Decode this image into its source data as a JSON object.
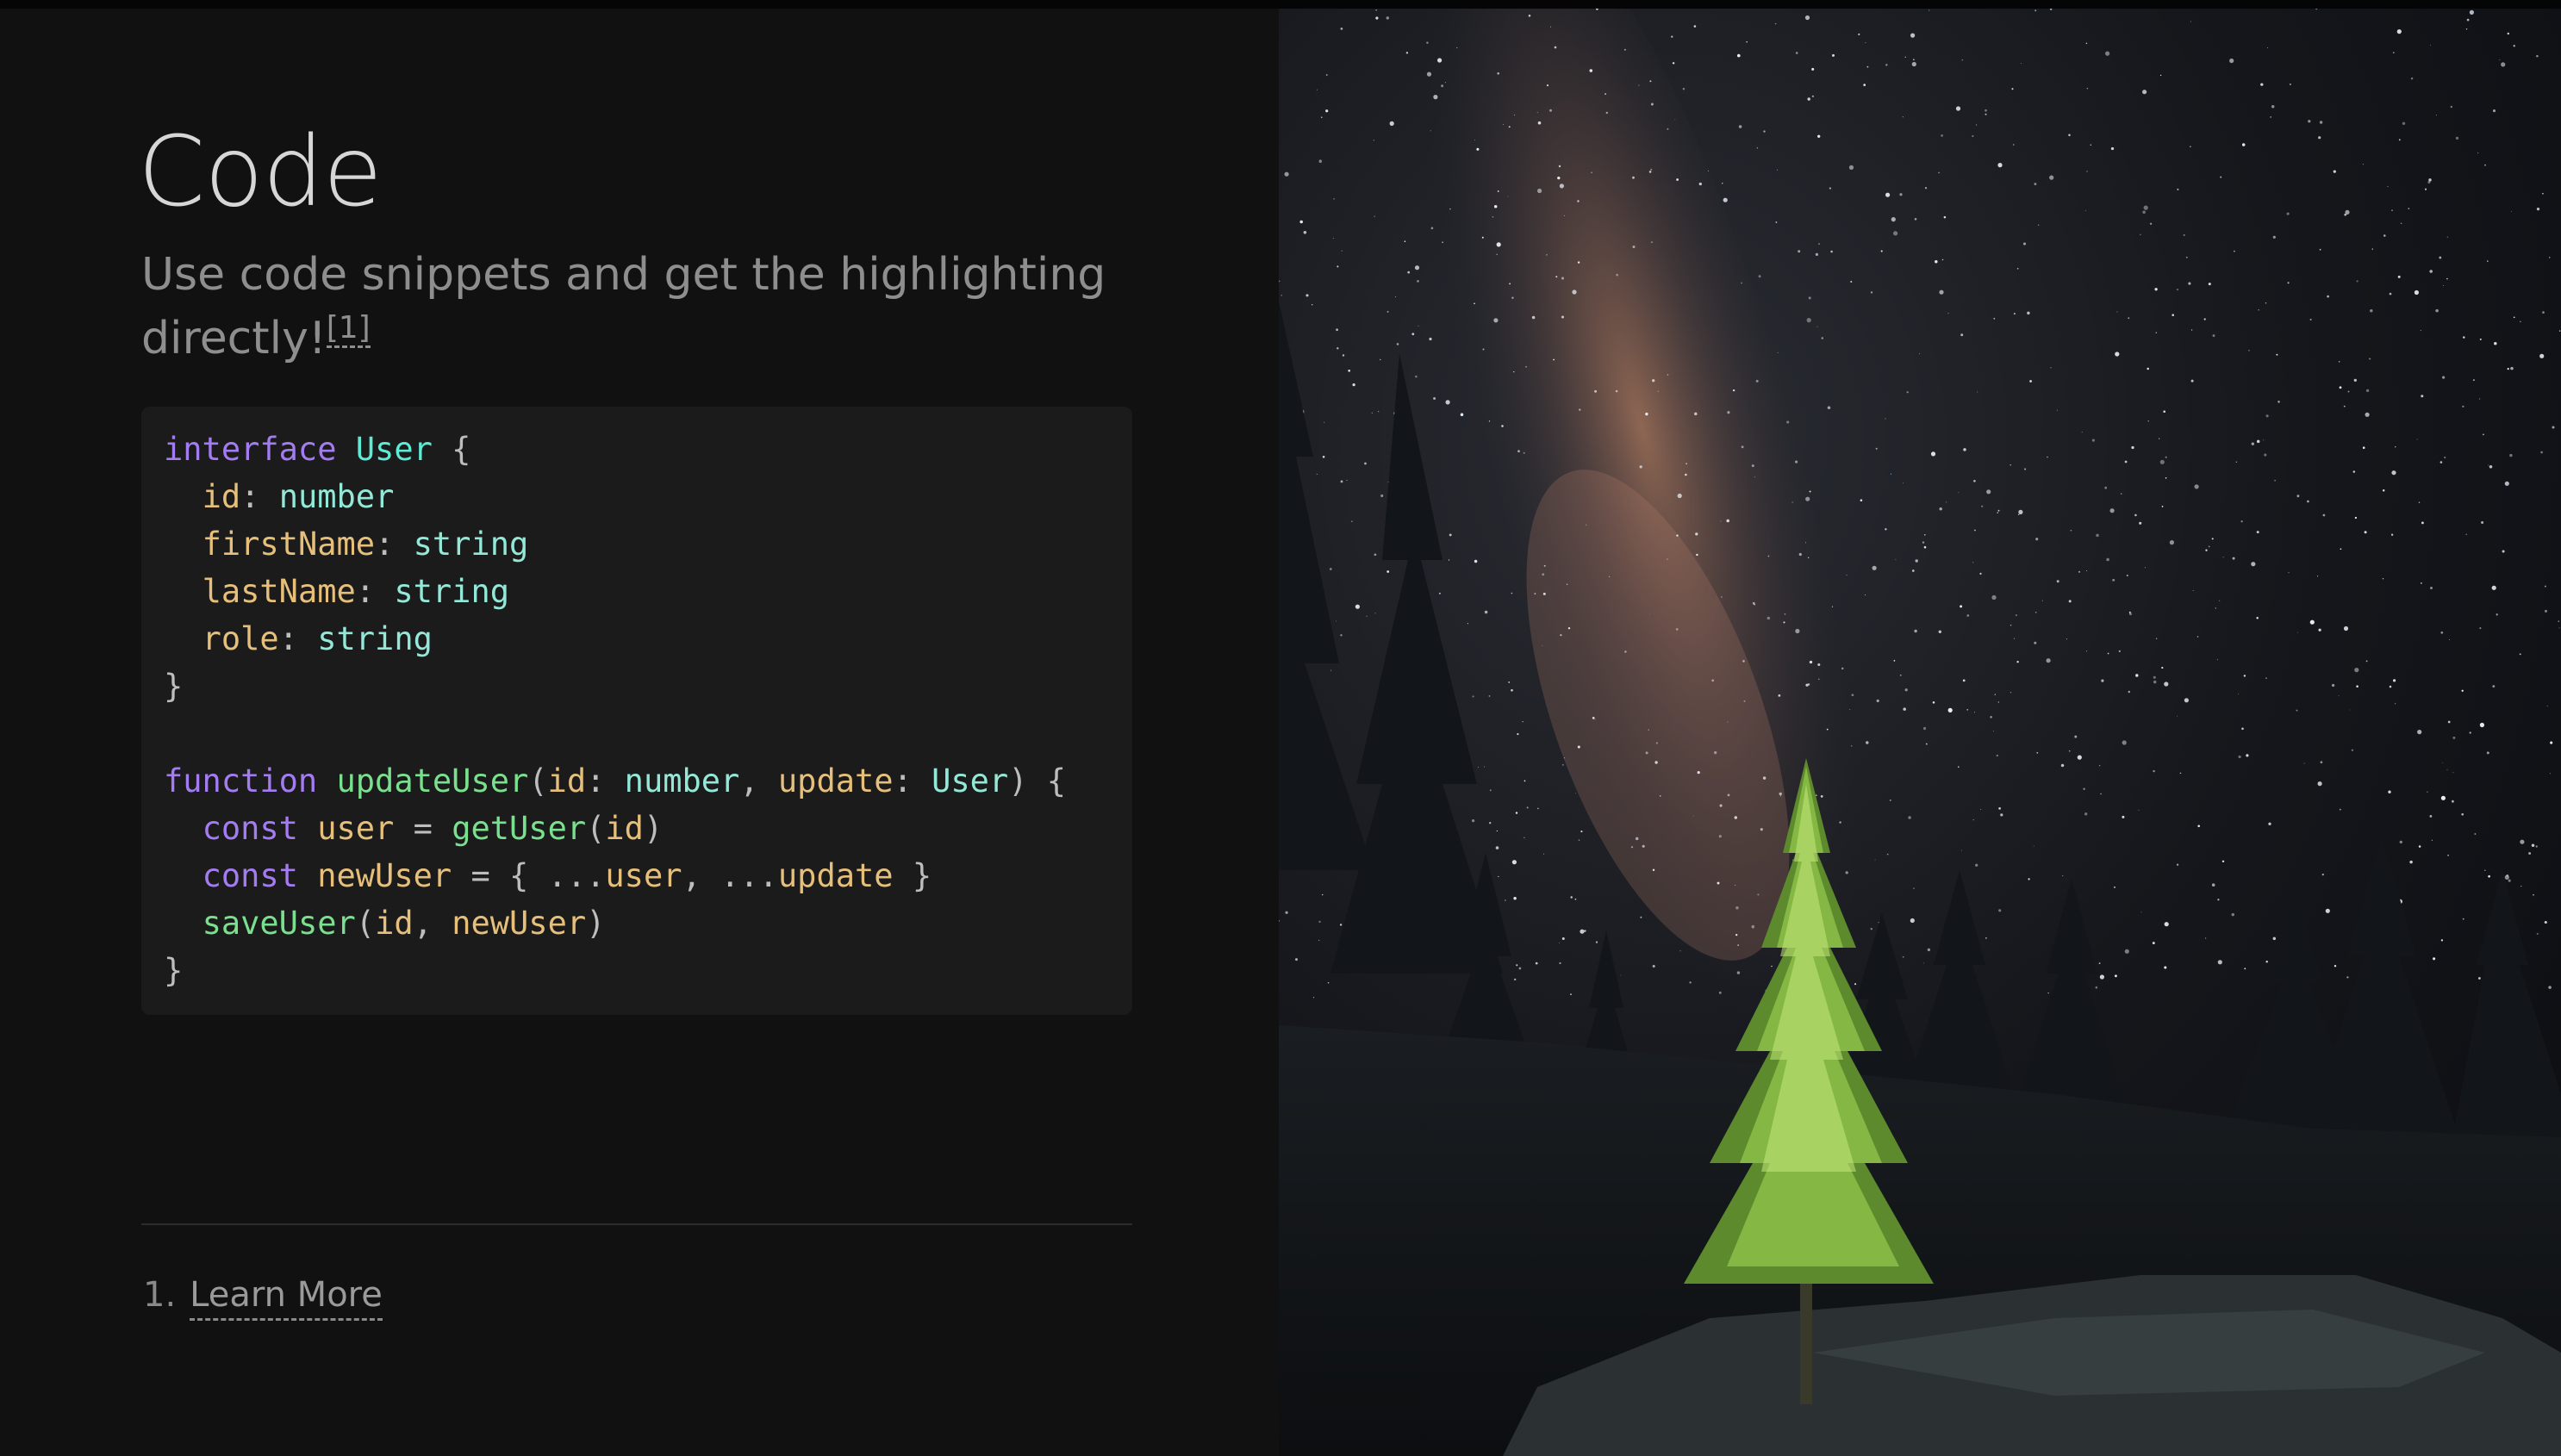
{
  "slide": {
    "title": "Code",
    "subtitle": "Use code snippets and get the highlighting directly!",
    "footnote_ref": "[1]"
  },
  "code": {
    "language": "typescript",
    "lines": [
      "interface User {",
      "  id: number",
      "  firstName: string",
      "  lastName: string",
      "  role: string",
      "}",
      "",
      "function updateUser(id: number, update: User) {",
      "  const user = getUser(id)",
      "  const newUser = { ...user, ...update }",
      "  saveUser(id, newUser)",
      "}"
    ]
  },
  "footnotes": [
    {
      "number": "1.",
      "label": "Learn More"
    }
  ],
  "image": {
    "subject": "night sky with milky way over pine trees"
  },
  "colors": {
    "background": "#111111",
    "code_background": "#1b1b1b",
    "keyword": "#a47cf2",
    "type": "#5eead4",
    "property": "#e6c07b",
    "function": "#79e08e"
  }
}
